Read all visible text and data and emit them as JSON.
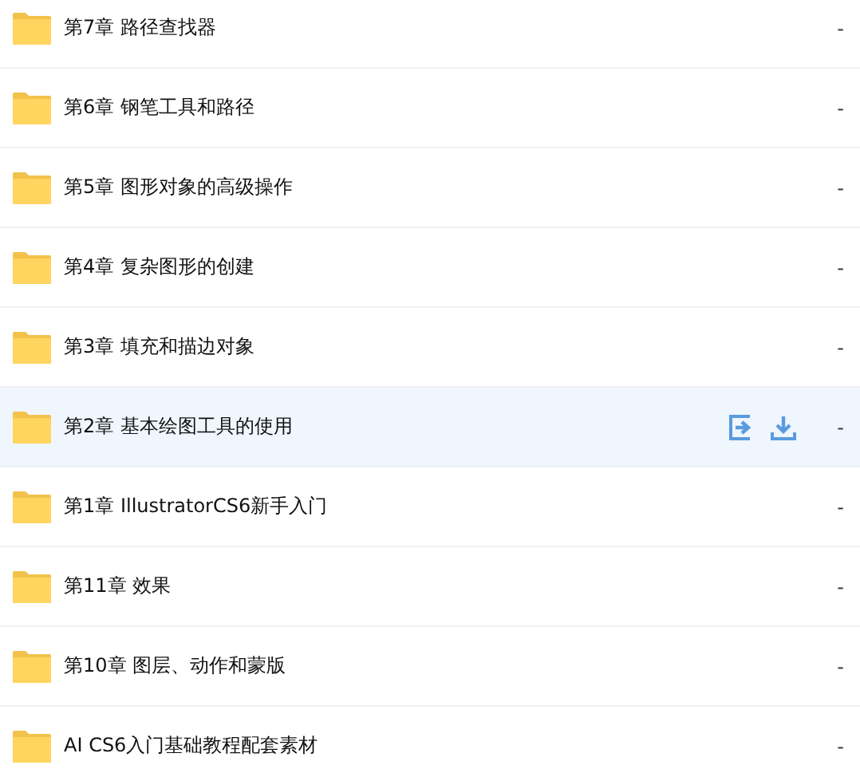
{
  "files": [
    {
      "name": "第7章 路径查找器",
      "size": "-",
      "selected": false
    },
    {
      "name": "第6章 钢笔工具和路径",
      "size": "-",
      "selected": false
    },
    {
      "name": "第5章 图形对象的高级操作",
      "size": "-",
      "selected": false
    },
    {
      "name": "第4章 复杂图形的创建",
      "size": "-",
      "selected": false
    },
    {
      "name": "第3章 填充和描边对象",
      "size": "-",
      "selected": false
    },
    {
      "name": "第2章 基本绘图工具的使用",
      "size": "-",
      "selected": true
    },
    {
      "name": "第1章 IllustratorCS6新手入门",
      "size": "-",
      "selected": false
    },
    {
      "name": "第11章 效果",
      "size": "-",
      "selected": false
    },
    {
      "name": "第10章 图层、动作和蒙版",
      "size": "-",
      "selected": false
    },
    {
      "name": "AI CS6入门基础教程配套素材",
      "size": "-",
      "selected": false
    }
  ]
}
